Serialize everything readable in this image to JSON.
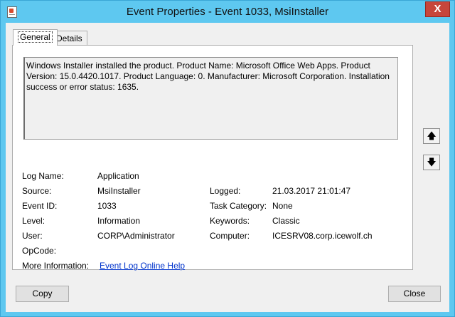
{
  "window": {
    "title": "Event Properties - Event 1033, MsiInstaller",
    "close_glyph": "X"
  },
  "tabs": [
    {
      "label": "General",
      "selected": true
    },
    {
      "label": "Details",
      "selected": false
    }
  ],
  "general": {
    "description": "Windows Installer installed the product. Product Name: Microsoft Office Web Apps. Product Version: 15.0.4420.1017. Product Language: 0. Manufacturer: Microsoft Corporation. Installation success or error status: 1635.",
    "log_name_label": "Log Name:",
    "log_name": "Application",
    "source_label": "Source:",
    "source": "MsiInstaller",
    "logged_label": "Logged:",
    "logged": "21.03.2017 21:01:47",
    "event_id_label": "Event ID:",
    "event_id": "1033",
    "task_category_label": "Task Category:",
    "task_category": "None",
    "level_label": "Level:",
    "level": "Information",
    "keywords_label": "Keywords:",
    "keywords": "Classic",
    "user_label": "User:",
    "user": "CORP\\Administrator",
    "computer_label": "Computer:",
    "computer": "ICESRV08.corp.icewolf.ch",
    "opcode_label": "OpCode:",
    "opcode": "",
    "more_info_label": "More Information:",
    "more_info_link": "Event Log Online Help"
  },
  "nav": {
    "up_glyph": "🡅",
    "down_glyph": "🡇"
  },
  "buttons": {
    "copy": "Copy",
    "close": "Close"
  },
  "icons": {
    "app": "event-viewer-icon",
    "up": "arrow-up-icon",
    "down": "arrow-down-icon"
  }
}
